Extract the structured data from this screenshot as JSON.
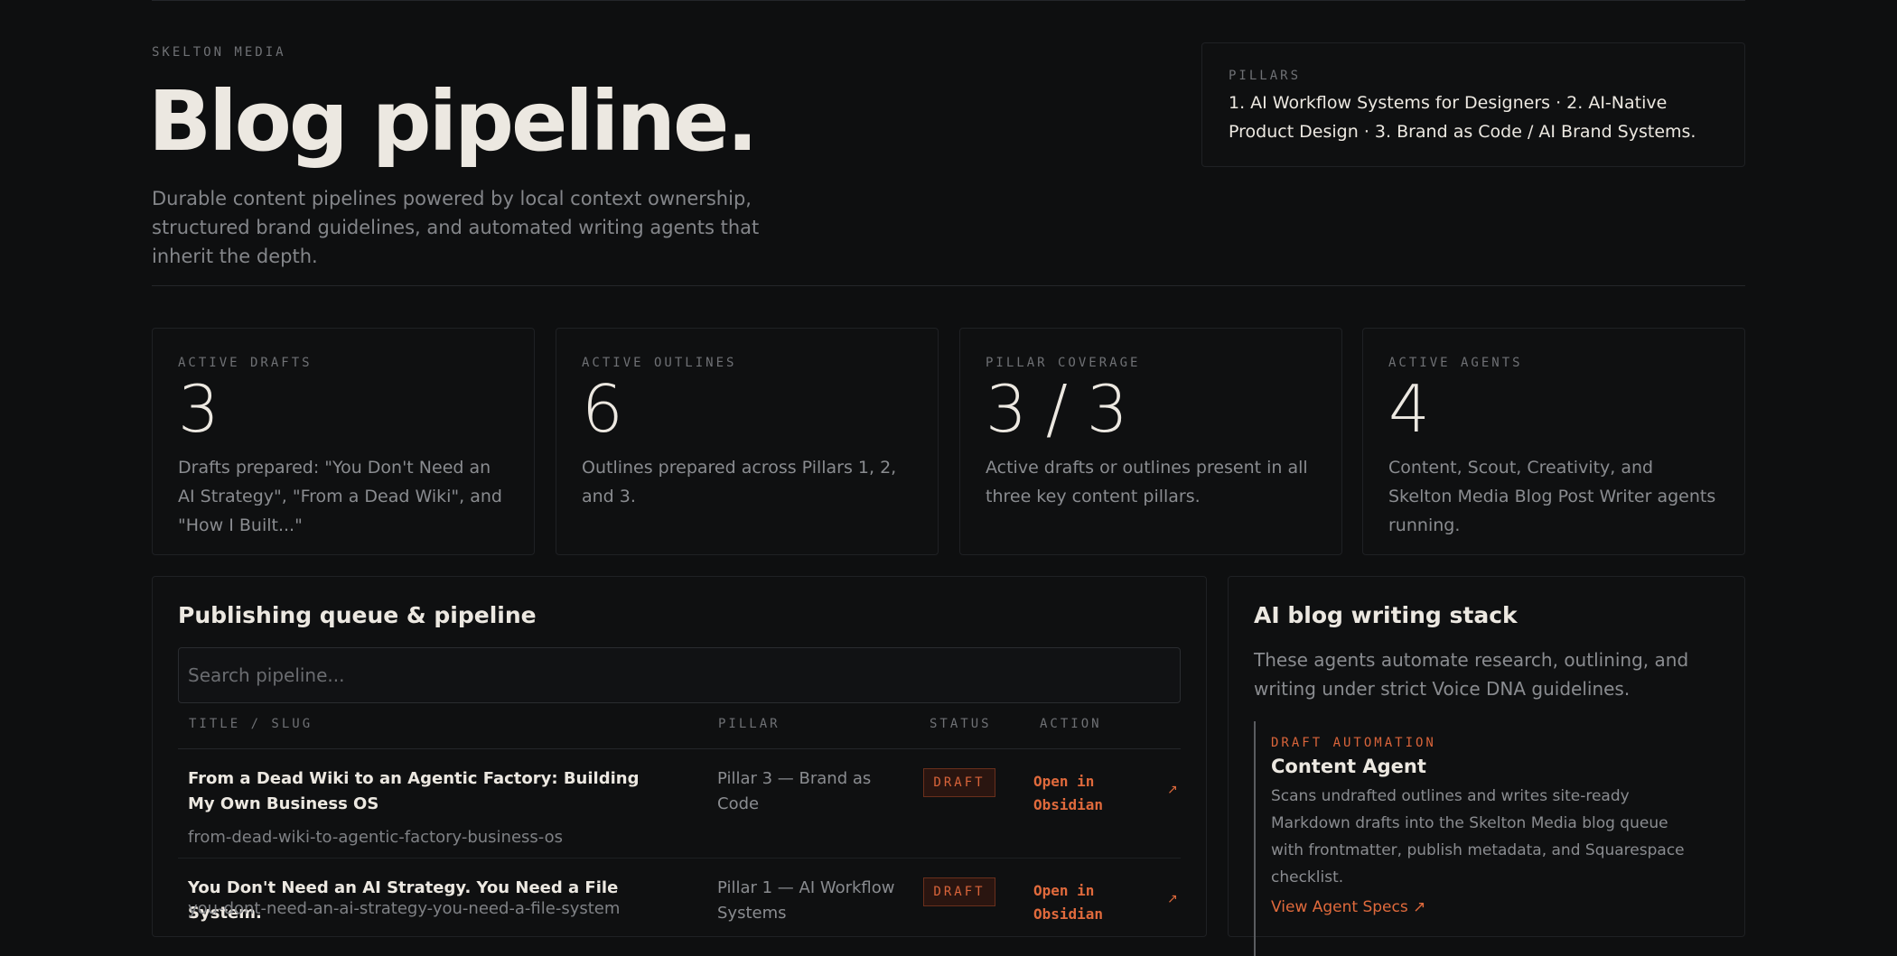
{
  "header": {
    "eyebrow": "SKELTON MEDIA",
    "title": "Blog pipeline.",
    "subtitle": "Durable content pipelines powered by local context ownership, structured brand guidelines, and automated writing agents that inherit the depth."
  },
  "pillars": {
    "label": "PILLARS",
    "text": "1. AI Workflow Systems for Designers · 2. AI-Native Product Design · 3. Brand as Code / AI Brand Systems."
  },
  "stats": [
    {
      "label": "ACTIVE DRAFTS",
      "value": "3",
      "desc": "Drafts prepared: \"You Don't Need an AI Strategy\", \"From a Dead Wiki\", and \"How I Built...\""
    },
    {
      "label": "ACTIVE OUTLINES",
      "value": "6",
      "desc": "Outlines prepared across Pillars 1, 2, and 3."
    },
    {
      "label": "PILLAR COVERAGE",
      "value": "3 / 3",
      "desc": "Active drafts or outlines present in all three key content pillars."
    },
    {
      "label": "ACTIVE AGENTS",
      "value": "4",
      "desc": "Content, Scout, Creativity, and Skelton Media Blog Post Writer agents running."
    }
  ],
  "queue": {
    "title": "Publishing queue & pipeline",
    "search_placeholder": "Search pipeline...",
    "columns": [
      "TITLE / SLUG",
      "PILLAR",
      "STATUS",
      "ACTION"
    ],
    "rows": [
      {
        "title": "From a Dead Wiki to an Agentic Factory: Building My Own Business OS",
        "slug": "from-dead-wiki-to-agentic-factory-business-os",
        "pillar": "Pillar 3 — Brand as Code",
        "status": "DRAFT",
        "action": "Open in Obsidian",
        "arrow": "↗"
      },
      {
        "title": "You Don't Need an AI Strategy. You Need a File System.",
        "slug": "you-dont-need-an-ai-strategy-you-need-a-file-system",
        "pillar": "Pillar 1 — AI Workflow Systems",
        "status": "DRAFT",
        "action": "Open in Obsidian",
        "arrow": "↗"
      }
    ]
  },
  "stack": {
    "title": "AI blog writing stack",
    "desc": "These agents automate research, outlining, and writing under strict Voice DNA guidelines.",
    "agent": {
      "eyebrow": "DRAFT AUTOMATION",
      "name": "Content Agent",
      "desc": "Scans undrafted outlines and writes site-ready Markdown drafts into the Skelton Media blog queue with frontmatter, publish metadata, and Squarespace checklist.",
      "link": "View Agent Specs ↗"
    }
  },
  "colors": {
    "background": "#0e0f10",
    "accent": "#e06a3c",
    "text": "#ece8e1",
    "muted": "#8a8c90"
  }
}
